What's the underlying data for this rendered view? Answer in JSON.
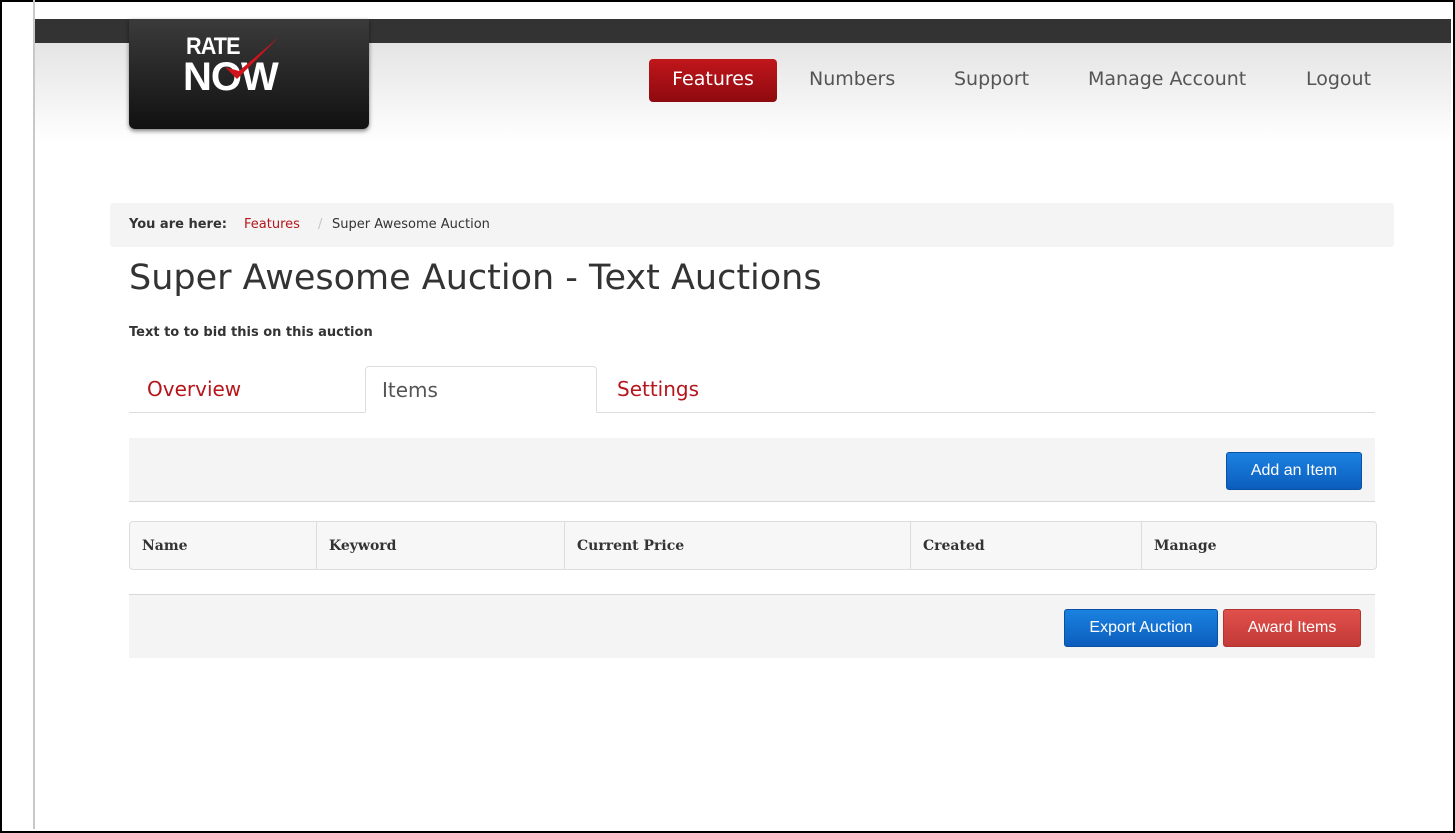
{
  "logo": {
    "line1": "RATE",
    "line2": "NOW"
  },
  "nav": {
    "items": [
      {
        "label": "Features",
        "active": true
      },
      {
        "label": "Numbers",
        "active": false
      },
      {
        "label": "Support",
        "active": false
      },
      {
        "label": "Manage Account",
        "active": false
      },
      {
        "label": "Logout",
        "active": false
      }
    ]
  },
  "breadcrumb": {
    "label": "You are here:",
    "link": "Features",
    "separator": "/",
    "current": "Super Awesome Auction"
  },
  "page": {
    "title": "Super Awesome Auction - Text Auctions",
    "subtitle": "Text to to bid this on this auction"
  },
  "tabs": [
    {
      "label": "Overview",
      "active": false
    },
    {
      "label": "Items",
      "active": true
    },
    {
      "label": "Settings",
      "active": false
    }
  ],
  "toolbar": {
    "add_item_label": "Add an Item"
  },
  "table": {
    "columns": [
      "Name",
      "Keyword",
      "Current Price",
      "Created",
      "Manage"
    ],
    "rows": []
  },
  "footer_actions": {
    "export_label": "Export Auction",
    "award_label": "Award Items"
  },
  "colors": {
    "brand_red": "#b5161b",
    "primary_blue": "#0c6fd6",
    "danger_red": "#d9534f",
    "header_dark": "#333333"
  }
}
